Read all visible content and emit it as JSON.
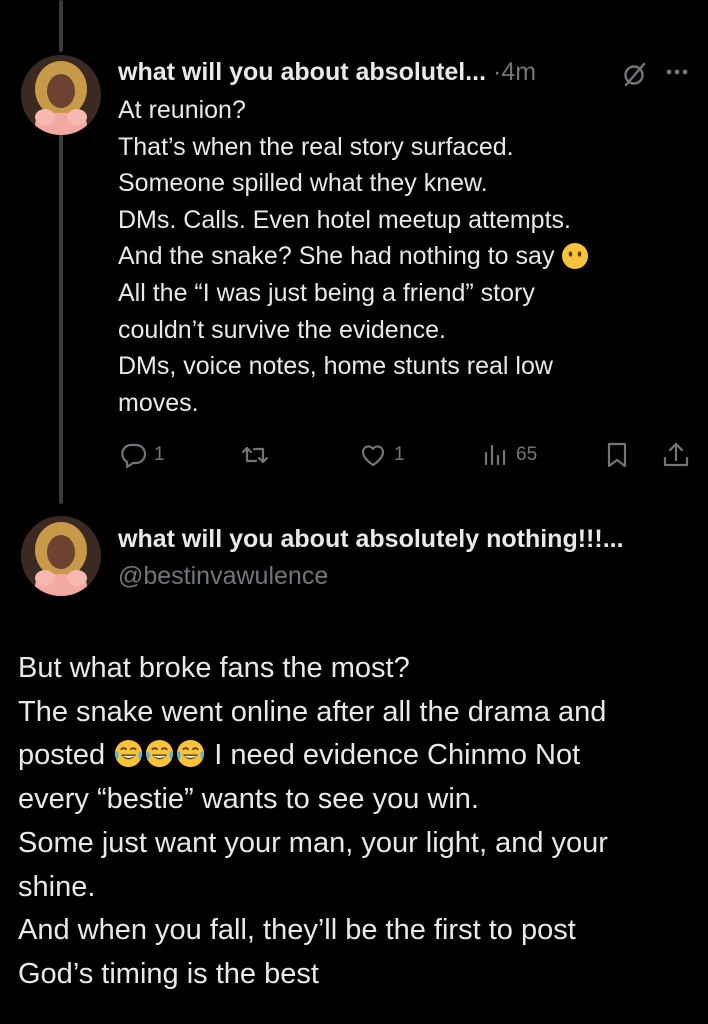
{
  "tweet1": {
    "display_name": "what will you about absolutel...",
    "separator": "·",
    "time": "4m",
    "body_lines": [
      "At reunion?",
      "That’s when the real story surfaced.",
      "Someone spilled what they knew.",
      "DMs. Calls. Even hotel meetup attempts.",
      "And the snake? She had nothing to say",
      "All the “I was just being a friend” story",
      "couldn’t survive the evidence.",
      "DMs, voice notes, home stunts real low",
      "moves."
    ],
    "body_emoji": "face-without-mouth",
    "actions": {
      "replies": "1",
      "reposts": "",
      "likes": "1",
      "views": "65"
    },
    "icons": {
      "grok": "grok-icon",
      "more": "more-icon",
      "reply": "reply-icon",
      "repost": "repost-icon",
      "like": "heart-icon",
      "views": "views-icon",
      "bookmark": "bookmark-icon",
      "share": "share-icon"
    }
  },
  "tweet2": {
    "display_name": "what will you about absolutely nothing!!!...",
    "handle": "@bestinvawulence",
    "body": {
      "l1": "But what broke fans the most?",
      "l2": "The snake went online after all the drama and",
      "l3a": "posted",
      "l3b": "I need evidence Chinmo Not",
      "l4": "every “bestie” wants to see you win.",
      "l5": "Some just want your man, your light, and your",
      "l6": "shine.",
      "l7": "And when you fall, they’ll be the first to post",
      "l8": "God’s timing is the best"
    },
    "emoji": "face-with-tears-of-joy"
  },
  "colors": {
    "background": "#000000",
    "text": "#e7e9ea",
    "muted": "#71767b",
    "thread_line": "#3a3d40"
  }
}
